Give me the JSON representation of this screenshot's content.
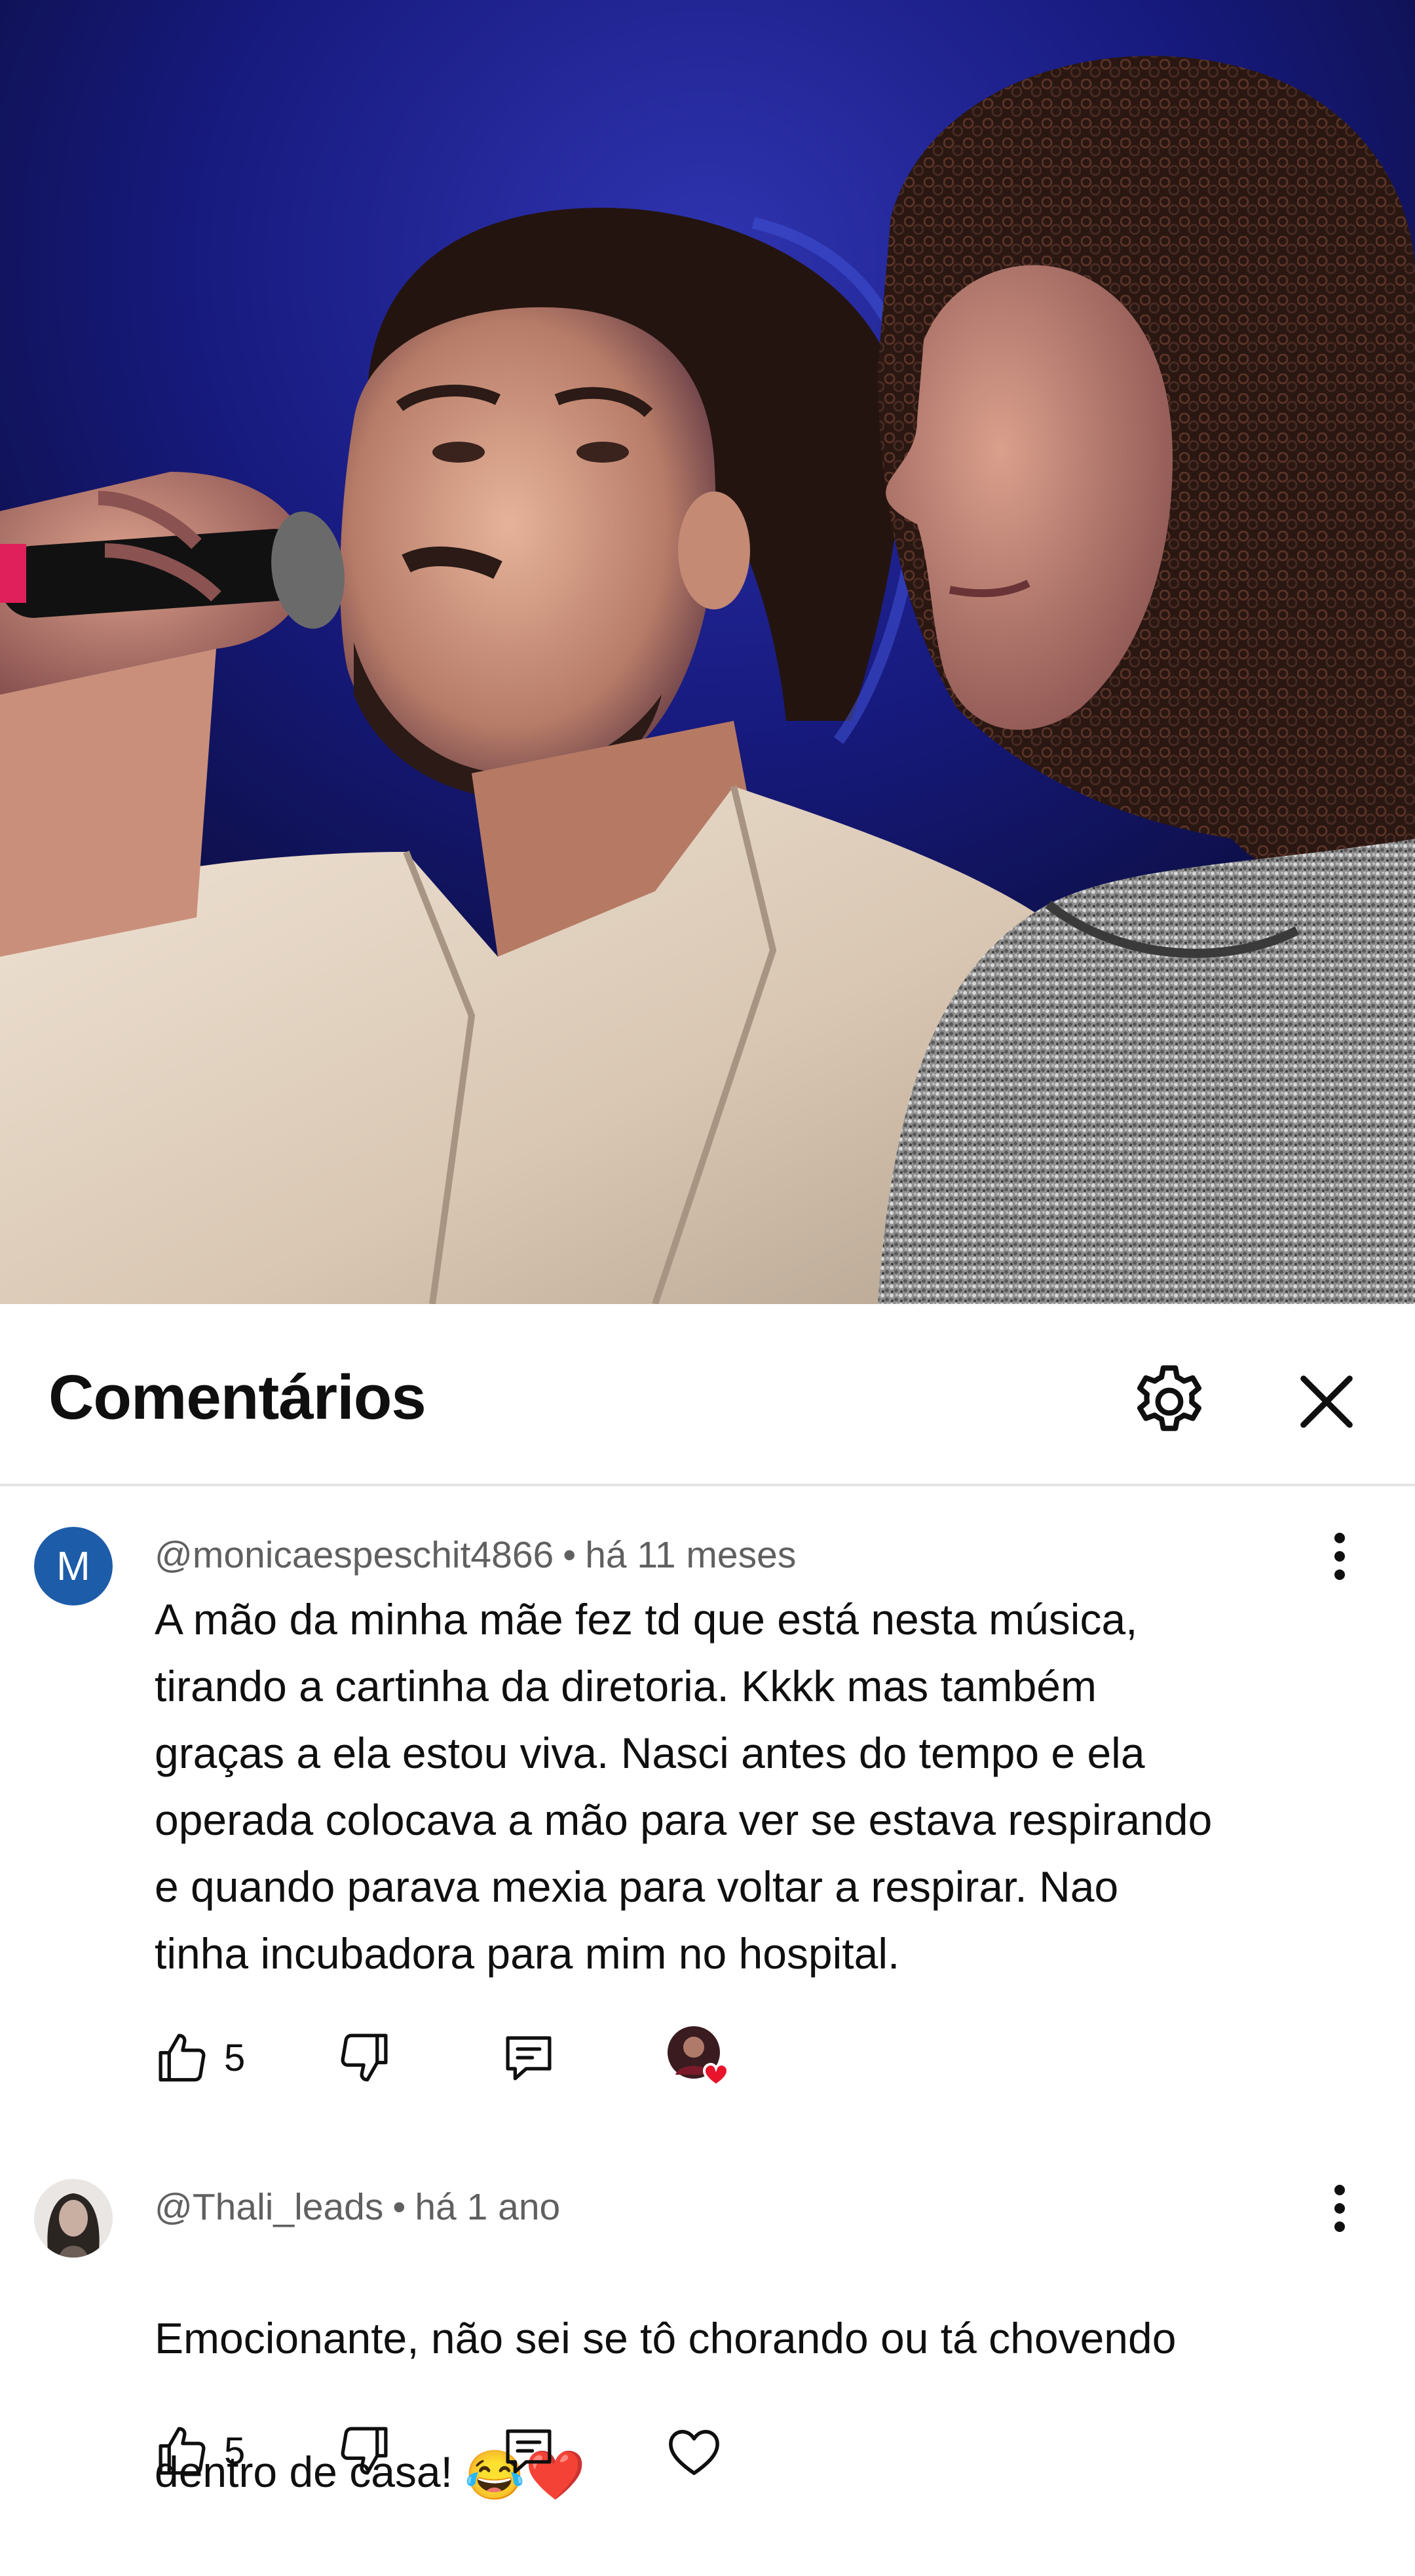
{
  "video": {
    "description_icon": "video-frame"
  },
  "header": {
    "title": "Comentários",
    "settings_icon": "gear-icon",
    "close_icon": "close-icon"
  },
  "comments": [
    {
      "avatar_letter": "M",
      "avatar_color": "#1d5ca8",
      "author": "@monicaespeschit4866",
      "time": "há 11 meses",
      "text": "A mão da minha mãe fez td que está nesta música,\ntirando a cartinha da diretoria.  Kkkk mas também\ngraças a ela estou viva. Nasci antes do tempo e ela\noperada colocava a mão para ver se estava respirando\ne quando parava mexia para voltar a respirar. Nao\ntinha incubadora para mim no hospital.",
      "likes": "5",
      "creator_heart": true
    },
    {
      "author": "@Thali_leads",
      "time": "há 1 ano",
      "text_line1": "Emocionante, não sei se tô chorando ou tá chovendo",
      "text_line2": "dentro de casa! ",
      "emoji1": "😂",
      "emoji2": "❤️",
      "likes": "5",
      "creator_heart": false
    }
  ],
  "colors": {
    "meta_text": "#606060",
    "heart_red": "#e8142c"
  }
}
